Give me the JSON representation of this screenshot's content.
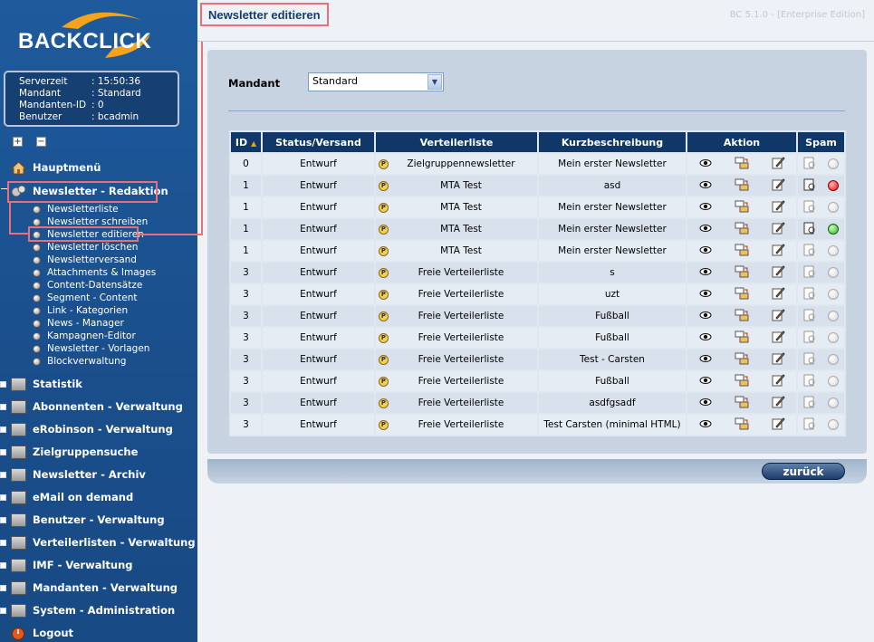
{
  "app": {
    "logo_text": "BACKCLICK",
    "version": "BC 5.1.0 - [Enterprise Edition]"
  },
  "server_info": [
    {
      "key": "Serverzeit",
      "value": ": 15:50:36"
    },
    {
      "key": "Mandant",
      "value": ": Standard"
    },
    {
      "key": "Mandanten-ID",
      "value": ": 0"
    },
    {
      "key": "Benutzer",
      "value": ": bcadmin"
    }
  ],
  "sidebar": {
    "home": "Hauptmenü",
    "redaktion": "Newsletter - Redaktion",
    "sub_items": [
      "Newsletterliste",
      "Newsletter schreiben",
      "Newsletter editieren",
      "Newsletter löschen",
      "Newsletterversand",
      "Attachments & Images",
      "Content-Datensätze",
      "Segment - Content",
      "Link - Kategorien",
      "News - Manager",
      "Kampagnen-Editor",
      "Newsletter - Vorlagen",
      "Blockverwaltung"
    ],
    "sections": [
      "Statistik",
      "Abonnenten - Verwaltung",
      "eRobinson - Verwaltung",
      "Zielgruppensuche",
      "Newsletter - Archiv",
      "eMail on demand",
      "Benutzer - Verwaltung",
      "Verteilerlisten - Verwaltung",
      "IMF - Verwaltung",
      "Mandanten - Verwaltung",
      "System - Administration"
    ],
    "logout": "Logout"
  },
  "page": {
    "title": "Newsletter editieren"
  },
  "form": {
    "mandant_label": "Mandant",
    "mandant_value": "Standard"
  },
  "table": {
    "headers": [
      "ID",
      "Status/Versand",
      "Verteilerliste",
      "Kurzbeschreibung",
      "Aktion",
      "Spam"
    ],
    "rows": [
      {
        "id": "0",
        "status": "Entwurf",
        "list": "Zielgruppennewsletter",
        "desc": "Mein erster Newsletter",
        "spam": "none"
      },
      {
        "id": "1",
        "status": "Entwurf",
        "list": "MTA Test",
        "desc": "asd",
        "spam": "red"
      },
      {
        "id": "1",
        "status": "Entwurf",
        "list": "MTA Test",
        "desc": "Mein erster Newsletter",
        "spam": "none"
      },
      {
        "id": "1",
        "status": "Entwurf",
        "list": "MTA Test",
        "desc": "Mein erster Newsletter",
        "spam": "green"
      },
      {
        "id": "1",
        "status": "Entwurf",
        "list": "MTA Test",
        "desc": "Mein erster Newsletter",
        "spam": "none"
      },
      {
        "id": "3",
        "status": "Entwurf",
        "list": "Freie Verteilerliste",
        "desc": "s",
        "spam": "none"
      },
      {
        "id": "3",
        "status": "Entwurf",
        "list": "Freie Verteilerliste",
        "desc": "uzt",
        "spam": "none"
      },
      {
        "id": "3",
        "status": "Entwurf",
        "list": "Freie Verteilerliste",
        "desc": "Fußball",
        "spam": "none"
      },
      {
        "id": "3",
        "status": "Entwurf",
        "list": "Freie Verteilerliste",
        "desc": "Fußball",
        "spam": "none"
      },
      {
        "id": "3",
        "status": "Entwurf",
        "list": "Freie Verteilerliste",
        "desc": "Test - Carsten",
        "spam": "none"
      },
      {
        "id": "3",
        "status": "Entwurf",
        "list": "Freie Verteilerliste",
        "desc": "Fußball",
        "spam": "none"
      },
      {
        "id": "3",
        "status": "Entwurf",
        "list": "Freie Verteilerliste",
        "desc": "asdfgsadf",
        "spam": "none"
      },
      {
        "id": "3",
        "status": "Entwurf",
        "list": "Freie Verteilerliste",
        "desc": "Test Carsten (minimal HTML)",
        "spam": "none"
      }
    ]
  },
  "buttons": {
    "back": "zurück"
  },
  "colors": {
    "sidebar": "#1e5a9c",
    "header": "#0f3768",
    "highlight": "#e8707a",
    "panel": "#c7d3e1"
  }
}
